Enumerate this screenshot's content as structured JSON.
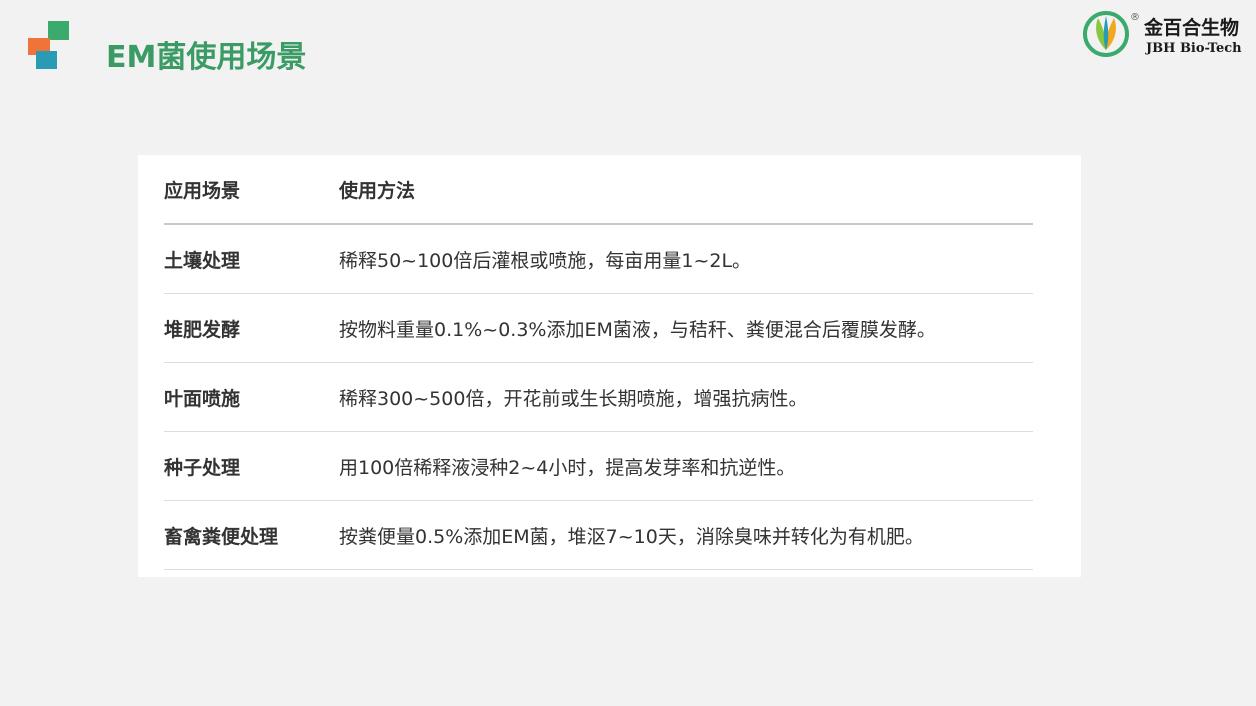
{
  "header": {
    "title": "EM菌使用场景"
  },
  "logo": {
    "registered": "®",
    "name_cn": "金百合生物",
    "name_en": "JBH Bio-Tech"
  },
  "table": {
    "columns": [
      "应用场景",
      "使用方法"
    ],
    "rows": [
      {
        "scene": "土壤处理",
        "method": "稀释50~100倍后灌根或喷施，每亩用量1~2L。"
      },
      {
        "scene": "堆肥发酵",
        "method": "按物料重量0.1%~0.3%添加EM菌液，与秸秆、粪便混合后覆膜发酵。"
      },
      {
        "scene": "叶面喷施",
        "method": "稀释300~500倍，开花前或生长期喷施，增强抗病性。"
      },
      {
        "scene": "种子处理",
        "method": "用100倍稀释液浸种2~4小时，提高发芽率和抗逆性。"
      },
      {
        "scene": "畜禽粪便处理",
        "method": "按粪便量0.5%添加EM菌，堆沤7~10天，消除臭味并转化为有机肥。"
      }
    ]
  },
  "colors": {
    "title_green": "#3a9b65",
    "square_green": "#3aaa6d",
    "square_orange": "#f0733a",
    "square_blue": "#2a9bb5"
  }
}
